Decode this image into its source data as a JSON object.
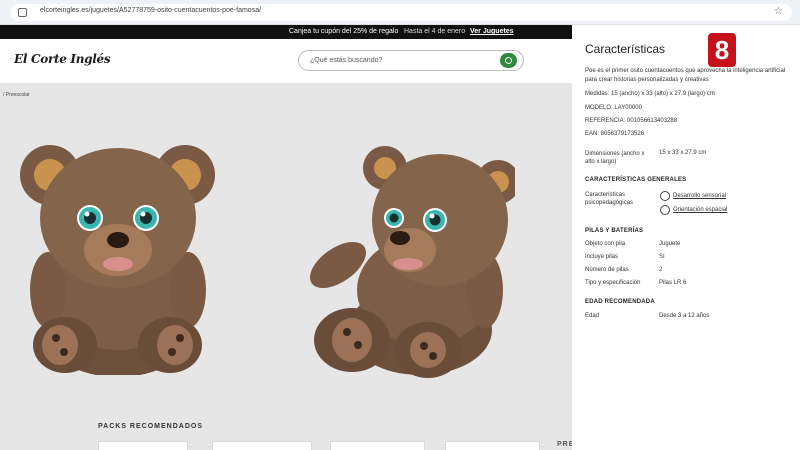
{
  "browser": {
    "url": "elcorteingles.es/juguetes/A52778759-osito-cuentacuentos-poe-famosa/"
  },
  "promo": {
    "text": "Canjea tu cupón del 25% de regalo",
    "date": "Hasta el 4 de enero",
    "link": "Ver Juguetes"
  },
  "header": {
    "logo": "El Corte Inglés",
    "search_placeholder": "¿Qué estás buscando?"
  },
  "breadcrumb": "/ Preescolar",
  "packs_label": "PACKS RECOMENDADOS",
  "pre_label": "PRE",
  "panel": {
    "title": "Características",
    "desc_line1": "Poe es el primer osito cuentacuentos que aprovecha la inteligencia artificial",
    "desc_line2": "para crear historias personalizadas y creativas",
    "medidas": "Medidas: 15 (ancho) x 33 (alto) x 27.9 (largo) cm",
    "modelo": "MODELO: LAY00000",
    "referencia": "REFERENCIA: 001056613403288",
    "ean": "EAN: 8056379173526",
    "dim_label": "Dimensiones (ancho x alto x largo)",
    "dim_value": "15 x 33 x 27.9 cm",
    "sec_general": "CARACTERÍSTICAS GENERALES",
    "psico_label": "Características psicopedagógicas",
    "psico_1": "Desarrollo sensorial",
    "psico_2": "Orientación espacial",
    "sec_pilas": "PILAS Y BATERÍAS",
    "objeto_label": "Objeto con pila",
    "objeto_value": "Juguete",
    "incluye_label": "Incluye pilas",
    "incluye_value": "Sí",
    "numero_label": "Número de pilas",
    "numero_value": "2",
    "tipo_label": "Tipo y especificación",
    "tipo_value": "Pilas LR 6",
    "sec_edad": "EDAD RECOMENDADA",
    "edad_label": "Edad",
    "edad_value": "Desde 3 a 12 años"
  },
  "tv": {
    "logo": "8"
  },
  "colors": {
    "search_button": "#2e8b3d",
    "promo_bg": "#111111",
    "tv_logo": "#c4111b"
  }
}
